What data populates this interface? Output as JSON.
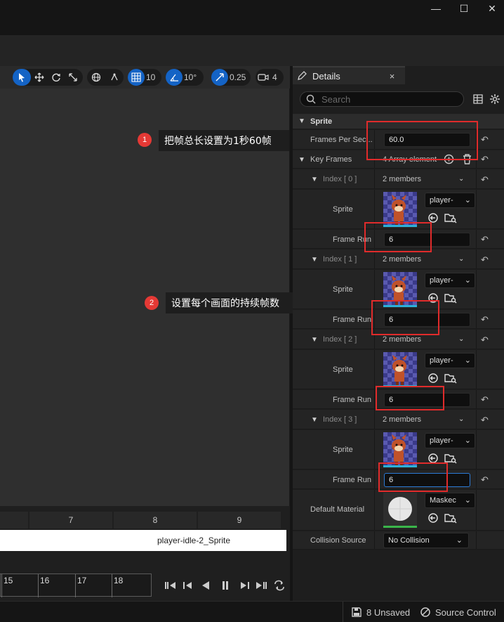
{
  "window": {
    "minimize": "—",
    "maximize": "☐",
    "close": "✕"
  },
  "toolbar": {
    "grid_value": "10",
    "rotation_value": "10°",
    "scale_value": "0.25",
    "camera_value": "4"
  },
  "timeline": {
    "frame_numbers": [
      "7",
      "8",
      "9"
    ],
    "sprite_track_label": "player-idle-2_Sprite",
    "ticks": [
      "15",
      "16",
      "17",
      "18"
    ]
  },
  "annotations": [
    {
      "number": "1",
      "text": "把帧总长设置为1秒60帧"
    },
    {
      "number": "2",
      "text": "设置每个画面的持续帧数"
    }
  ],
  "details": {
    "tab_title": "Details",
    "tab_close": "×",
    "search_placeholder": "Search",
    "sprite_category": "Sprite",
    "frames_per_second_label": "Frames Per Sec...",
    "frames_per_second_value": "60.0",
    "key_frames_label": "Key Frames",
    "key_frames_value": "4 Array element",
    "keyframes": [
      {
        "index_label": "Index [ 0 ]",
        "members": "2 members",
        "sprite_label": "Sprite",
        "sprite_value": "player-",
        "frame_run_label": "Frame Run",
        "frame_run_value": "6"
      },
      {
        "index_label": "Index [ 1 ]",
        "members": "2 members",
        "sprite_label": "Sprite",
        "sprite_value": "player-",
        "frame_run_label": "Frame Run",
        "frame_run_value": "6"
      },
      {
        "index_label": "Index [ 2 ]",
        "members": "2 members",
        "sprite_label": "Sprite",
        "sprite_value": "player-",
        "frame_run_label": "Frame Run",
        "frame_run_value": "6"
      },
      {
        "index_label": "Index [ 3 ]",
        "members": "2 members",
        "sprite_label": "Sprite",
        "sprite_value": "player-",
        "frame_run_label": "Frame Run",
        "frame_run_value": "6"
      }
    ],
    "default_material_label": "Default Material",
    "default_material_value": "Maskec",
    "collision_source_label": "Collision Source",
    "collision_source_value": "No Collision"
  },
  "statusbar": {
    "unsaved": "8 Unsaved",
    "source_control": "Source Control"
  },
  "colors": {
    "accent": "#1463c5",
    "annotation_red": "#e02b2b",
    "panel_bg": "#1e1e1e"
  }
}
